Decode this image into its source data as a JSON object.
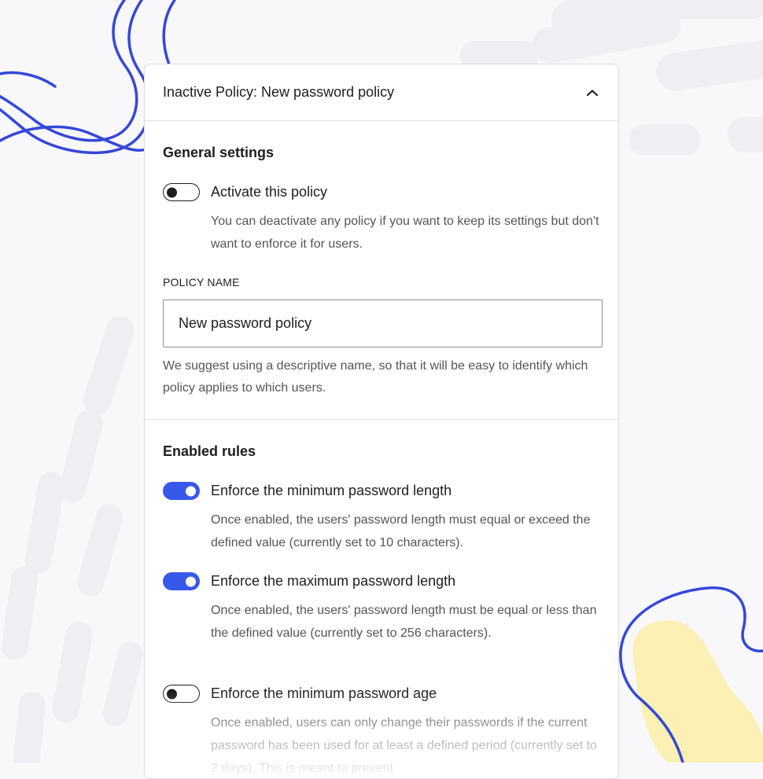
{
  "panel": {
    "title": "Inactive Policy: New password policy"
  },
  "general": {
    "heading": "General settings",
    "activate": {
      "label": "Activate this policy",
      "enabled": false,
      "help": "You can deactivate any policy if you want to keep its settings but don't want to enforce it for users."
    },
    "policy_name": {
      "label": "POLICY NAME",
      "value": "New password policy",
      "help": "We suggest using a descriptive name, so that it will be easy to identify which policy applies to which users."
    }
  },
  "rules": {
    "heading": "Enabled rules",
    "items": [
      {
        "label": "Enforce the minimum password length",
        "enabled": true,
        "help": "Once enabled, the users' password length must equal or exceed the defined value (currently set to 10 characters)."
      },
      {
        "label": "Enforce the maximum password length",
        "enabled": true,
        "help": "Once enabled, the users' password length must be equal or less than the defined value (currently set to 256 characters)."
      },
      {
        "label": "Enforce the minimum password age",
        "enabled": false,
        "help": "Once enabled, users can only change their passwords if the current password has been used for at least a defined period (currently set to 2 days). This is meant to prevent"
      }
    ]
  },
  "colors": {
    "accent": "#3858e9",
    "decoration_line": "#3547d9",
    "decoration_blob": "#fdf0b4"
  },
  "icons": {
    "collapse": "chevron-up-icon"
  }
}
